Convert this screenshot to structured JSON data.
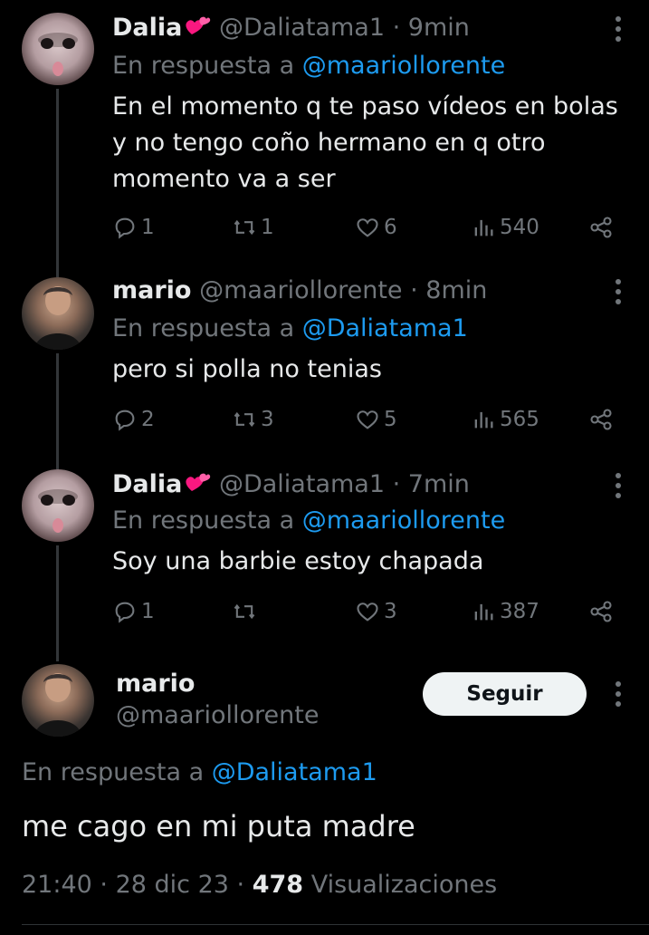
{
  "tweets": [
    {
      "name": "Dalia",
      "handle": "@Daliatama1",
      "time": "· 9min",
      "reply_prefix": "En respuesta a ",
      "reply_to": "@maariollorente",
      "text": "En el momento q te paso vídeos en bolas y no tengo coño hermano en q otro momento va a ser",
      "replies": "1",
      "retweets": "1",
      "likes": "6",
      "views": "540"
    },
    {
      "name": "mario",
      "handle": "@maariollorente",
      "time": "· 8min",
      "reply_prefix": "En respuesta a ",
      "reply_to": "@Daliatama1",
      "text": "pero si polla no tenias",
      "replies": "2",
      "retweets": "3",
      "likes": "5",
      "views": "565"
    },
    {
      "name": "Dalia",
      "handle": "@Daliatama1",
      "time": "· 7min",
      "reply_prefix": "En respuesta a ",
      "reply_to": "@maariollorente",
      "text": "Soy una barbie estoy chapada",
      "replies": "1",
      "retweets": "",
      "likes": "3",
      "views": "387"
    }
  ],
  "main": {
    "name": "mario",
    "handle": "@maariollorente",
    "follow_label": "Seguir",
    "reply_prefix": "En respuesta a ",
    "reply_to": "@Daliatama1",
    "text": "me cago en mi puta madre",
    "time": "21:40",
    "date": "28 dic 23",
    "views_count": "478",
    "views_label": "Visualizaciones"
  },
  "icons": [
    "reply-icon",
    "retweet-icon",
    "like-icon",
    "views-icon",
    "share-icon",
    "more-icon",
    "heart-emoji"
  ],
  "colors": {
    "background": "#000000",
    "text": "#e7e9ea",
    "muted": "#71767b",
    "link": "#1d9bf0",
    "emoji": "#f91880"
  }
}
